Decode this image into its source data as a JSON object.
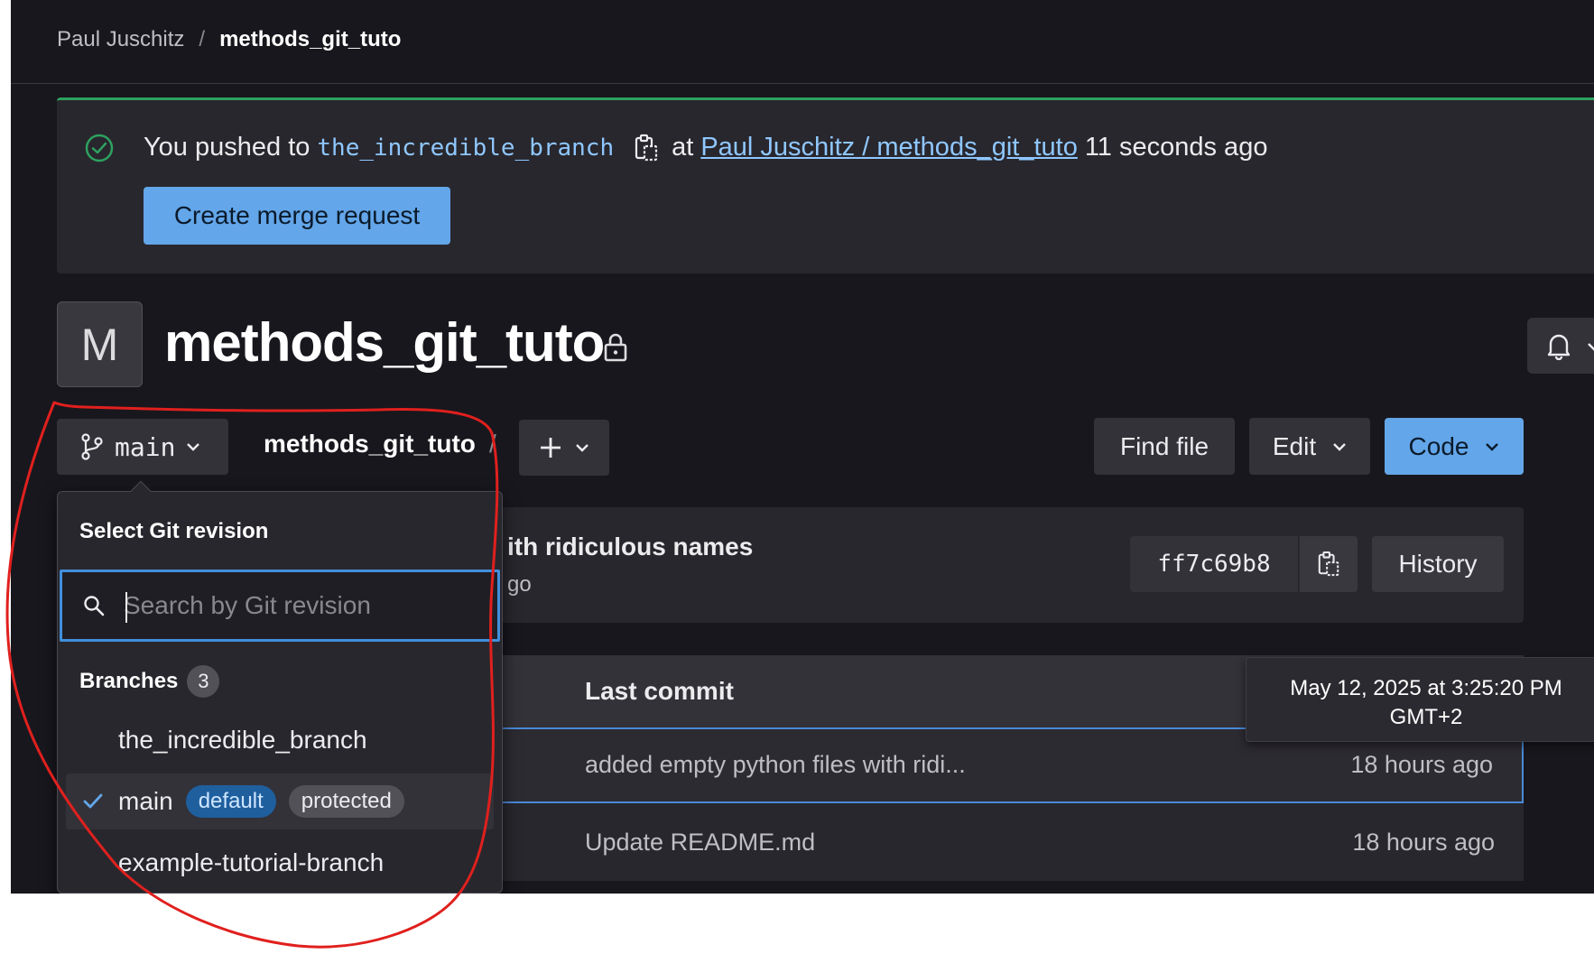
{
  "breadcrumb": {
    "owner": "Paul Juschitz",
    "separator": "/",
    "project": "methods_git_tuto"
  },
  "alert": {
    "prefix": "You pushed to",
    "branch": "the_incredible_branch",
    "middle": "at",
    "link": "Paul Juschitz / methods_git_tuto",
    "suffix": "11 seconds ago",
    "button": "Create merge request"
  },
  "project": {
    "avatar_letter": "M",
    "title": "methods_git_tuto"
  },
  "toolbar": {
    "branch": "main",
    "path": "methods_git_tuto",
    "path_sep": "/",
    "find_file": "Find file",
    "edit": "Edit",
    "code": "Code"
  },
  "last_commit": {
    "title": "ith ridiculous names",
    "sub": "go",
    "sha": "ff7c69b8",
    "history": "History"
  },
  "table": {
    "header": "Last commit",
    "rows": [
      {
        "message": "added empty python files with ridi...",
        "time": "18 hours ago"
      },
      {
        "message": "Update README.md",
        "time": "18 hours ago"
      }
    ]
  },
  "tooltip": {
    "line1": "May 12, 2025 at 3:25:20 PM",
    "line2": "GMT+2"
  },
  "dropdown": {
    "title": "Select Git revision",
    "search_placeholder": "Search by Git revision",
    "section": "Branches",
    "count": "3",
    "items": [
      {
        "name": "the_incredible_branch"
      },
      {
        "name": "main",
        "badge_default": "default",
        "badge_protected": "protected"
      },
      {
        "name": "example-tutorial-branch"
      }
    ]
  },
  "colors": {
    "accent": "#63a6e9",
    "success": "#2da160",
    "annotation": "#e0201e",
    "link": "#8fc7ff"
  }
}
